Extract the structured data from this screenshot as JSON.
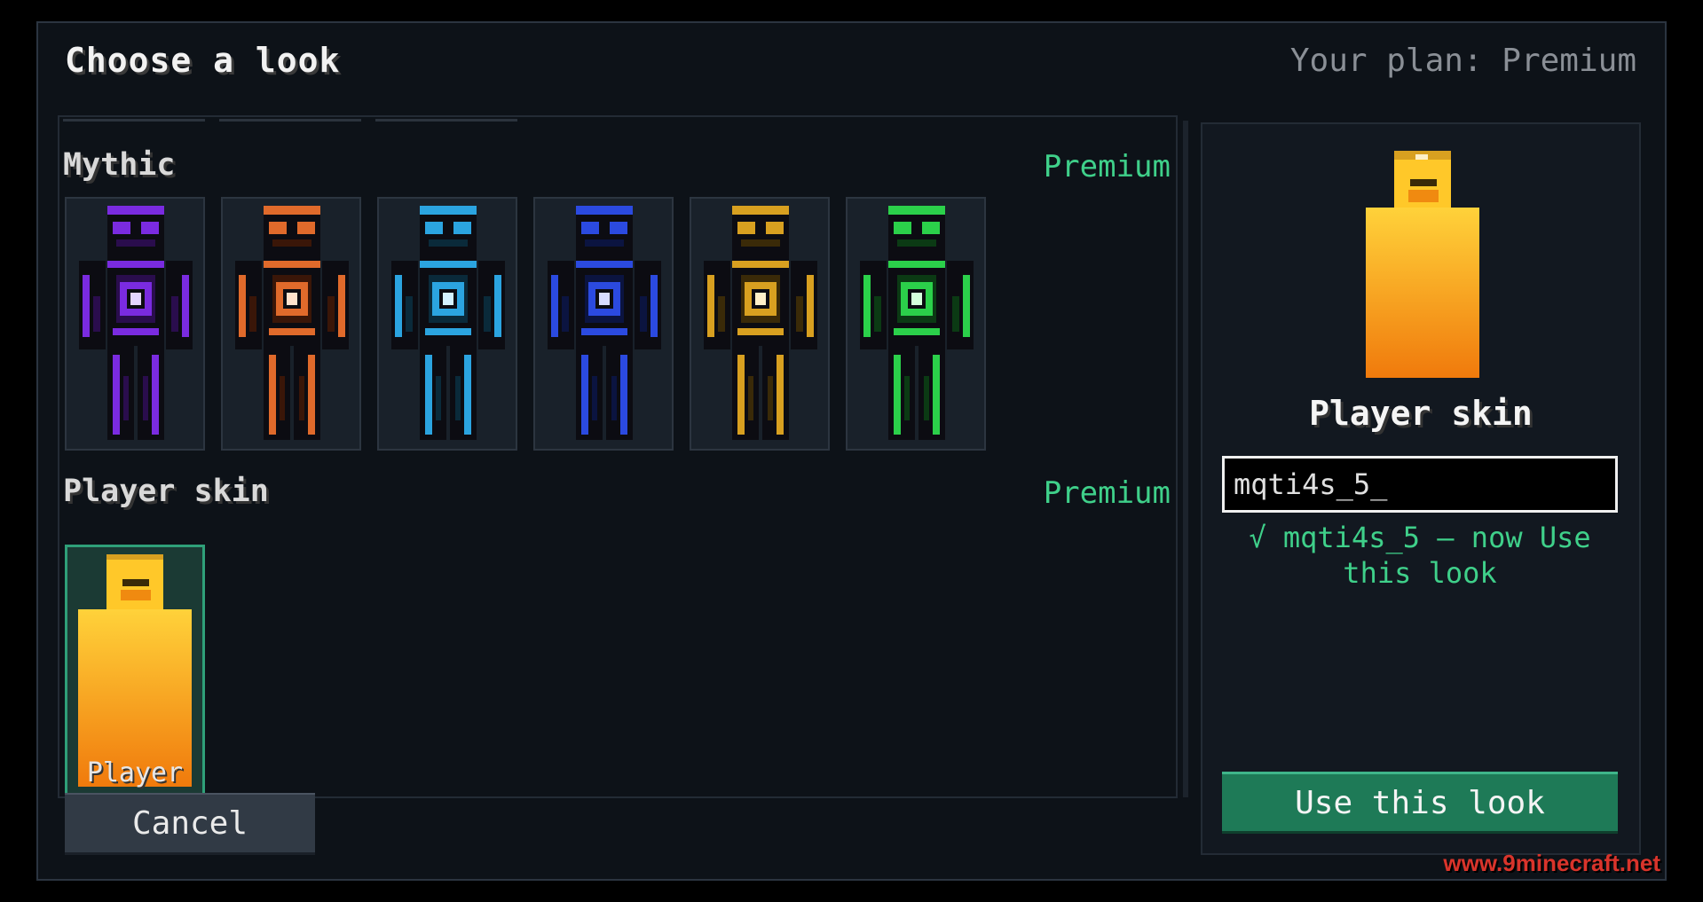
{
  "dialog": {
    "title": "Choose a look",
    "plan": "Your plan: Premium"
  },
  "sections": [
    {
      "title": "Mythic",
      "tier": "Premium",
      "skins": [
        {
          "color": "purple",
          "primary": "#7a2be0",
          "dark": "#2a0d4d",
          "core": "#e4d4ff"
        },
        {
          "color": "orange",
          "primary": "#e06a2b",
          "dark": "#3a1608",
          "core": "#ffe2cc"
        },
        {
          "color": "cyan",
          "primary": "#2ba4e0",
          "dark": "#0a2a3a",
          "core": "#d4f2ff"
        },
        {
          "color": "blue",
          "primary": "#2b4ae0",
          "dark": "#0b1440",
          "core": "#d8dcff"
        },
        {
          "color": "gold",
          "primary": "#d8a020",
          "dark": "#3a2a08",
          "core": "#fff0c8"
        },
        {
          "color": "green",
          "primary": "#2bd04a",
          "dark": "#0b3a14",
          "core": "#d4ffdc"
        }
      ]
    },
    {
      "title": "Player skin",
      "tier": "Premium",
      "skins": [
        {
          "label": "Player"
        }
      ]
    }
  ],
  "preview": {
    "name": "Player skin",
    "input_value": "mqti4s_5_",
    "status": "√ mqti4s_5 — now Use this look"
  },
  "buttons": {
    "use": "Use this look",
    "cancel": "Cancel"
  },
  "watermark": "www.9minecraft.net"
}
